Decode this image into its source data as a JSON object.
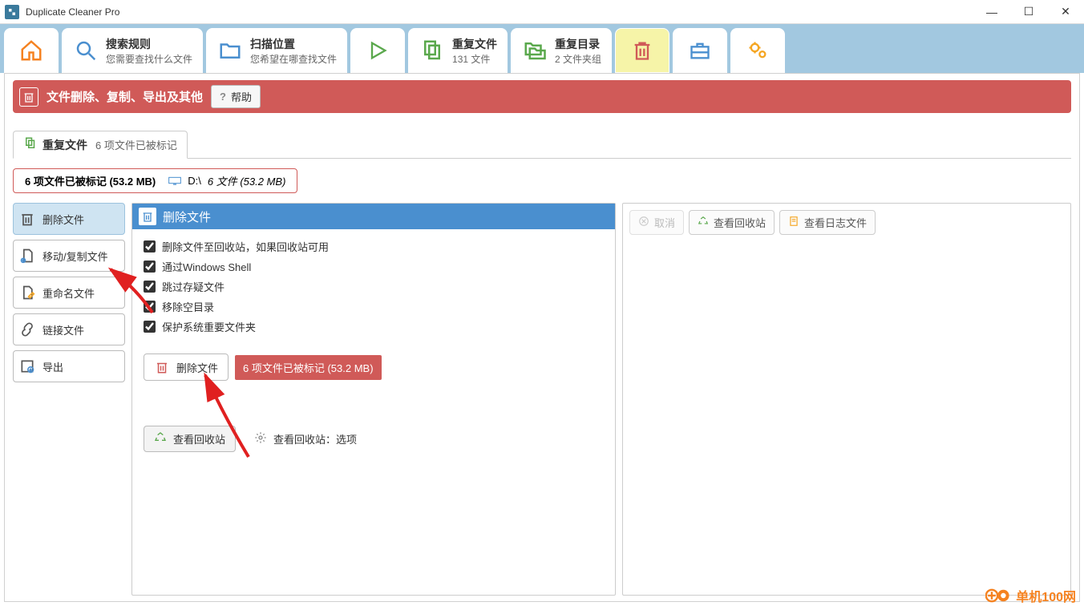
{
  "app": {
    "title": "Duplicate Cleaner Pro"
  },
  "wincontrols": {
    "min": "—",
    "max": "☐",
    "close": "✕"
  },
  "toolbar": {
    "home": "",
    "search_rules": {
      "title": "搜索规则",
      "sub": "您需要查找什么文件"
    },
    "scan_loc": {
      "title": "扫描位置",
      "sub": "您希望在哪查找文件"
    },
    "play": "",
    "dup_files": {
      "title": "重复文件",
      "sub": "131 文件"
    },
    "dup_dirs": {
      "title": "重复目录",
      "sub": "2 文件夹组"
    }
  },
  "banner": {
    "title": "文件删除、复制、导出及其他",
    "help": "帮助"
  },
  "subtab": {
    "label": "重复文件",
    "count": "6 项文件已被标记"
  },
  "info": {
    "marked": "6 项文件已被标记 (53.2 MB)",
    "drive_label": "D:\\",
    "drive_files": "6 文件 (53.2 MB)"
  },
  "side": {
    "delete": "删除文件",
    "movecopy": "移动/复制文件",
    "rename": "重命名文件",
    "link": "链接文件",
    "export": "导出"
  },
  "center": {
    "header": "删除文件",
    "chk1": "删除文件至回收站，如果回收站可用",
    "chk2": "通过Windows Shell",
    "chk3": "跳过存疑文件",
    "chk4": "移除空目录",
    "chk5": "保护系统重要文件夹",
    "delete_btn": "删除文件",
    "delete_badge": "6 项文件已被标记 (53.2 MB)",
    "view_recycle": "查看回收站",
    "recycle_opts": "查看回收站：选项"
  },
  "right": {
    "cancel": "取消",
    "view_recycle": "查看回收站",
    "view_log": "查看日志文件"
  },
  "watermark": {
    "text": "单机100网"
  }
}
